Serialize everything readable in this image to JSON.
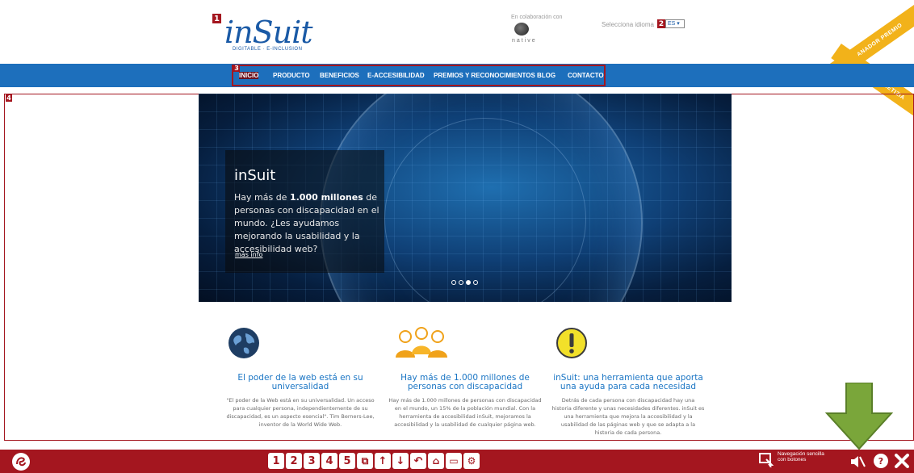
{
  "header": {
    "logo_text": "inSuit",
    "logo_subtext": "DIGITABLE · E-INCLUSION",
    "collab_label": "En colaboración con",
    "partner_name": "native",
    "language_label": "Selecciona idioma",
    "language_value": "ES",
    "ribbon_top": "GANADOR PREMIO",
    "ribbon_bottom": "REINA LETIZIA"
  },
  "badges": {
    "b1": "1",
    "b2": "2",
    "b3": "3",
    "b4": "4"
  },
  "nav": {
    "items": [
      {
        "label": "INICIO"
      },
      {
        "label": "PRODUCTO"
      },
      {
        "label": "BENEFICIOS"
      },
      {
        "label": "E-ACCESIBILIDAD"
      },
      {
        "label": "PREMIOS Y RECONOCIMIENTOS"
      },
      {
        "label": "BLOG"
      },
      {
        "label": "CONTACTO"
      }
    ]
  },
  "hero": {
    "title": "inSuit",
    "text_before": "Hay más de ",
    "text_bold": "1.000 millones",
    "text_after": " de personas con discapacidad en el mundo. ¿Les ayudamos mejorando la usabilidad y la accesibilidad web?",
    "link": "más info"
  },
  "features": [
    {
      "icon": "globe-icon",
      "title": "El poder de la web está en su universalidad",
      "body": "\"El poder de la Web está en su universalidad. Un acceso para cualquier persona, independientemente de su discapacidad, es un aspecto esencial\". Tim Berners-Lee, inventor de la World Wide Web."
    },
    {
      "icon": "people-icon",
      "title": "Hay más de 1.000 millones de personas con discapacidad",
      "body": "Hay más de 1.000 millones de personas con discapacidad en el mundo, un 15% de la población mundial. Con la herramienta de accesibilidad inSuit, mejoramos la accesibilidad y la usabilidad de cualquier página web."
    },
    {
      "icon": "exclamation-icon",
      "title": "inSuit: una herramienta que aporta una ayuda para cada necesidad",
      "body": "Detrás de cada persona con discapacidad hay una historia diferente y unas necesidades diferentes. inSuit es una herramienta que mejora la accesibilidad y la usabilidad de las páginas web y que se adapta a la historia de cada persona."
    }
  ],
  "toolbar": {
    "numbers": [
      "1",
      "2",
      "3",
      "4",
      "5"
    ],
    "nav_label": "Navegación sencilla con botones",
    "colors": {
      "bar": "#a4161f",
      "accent": "#1d6fbc",
      "arrow": "#7aa63a"
    }
  }
}
